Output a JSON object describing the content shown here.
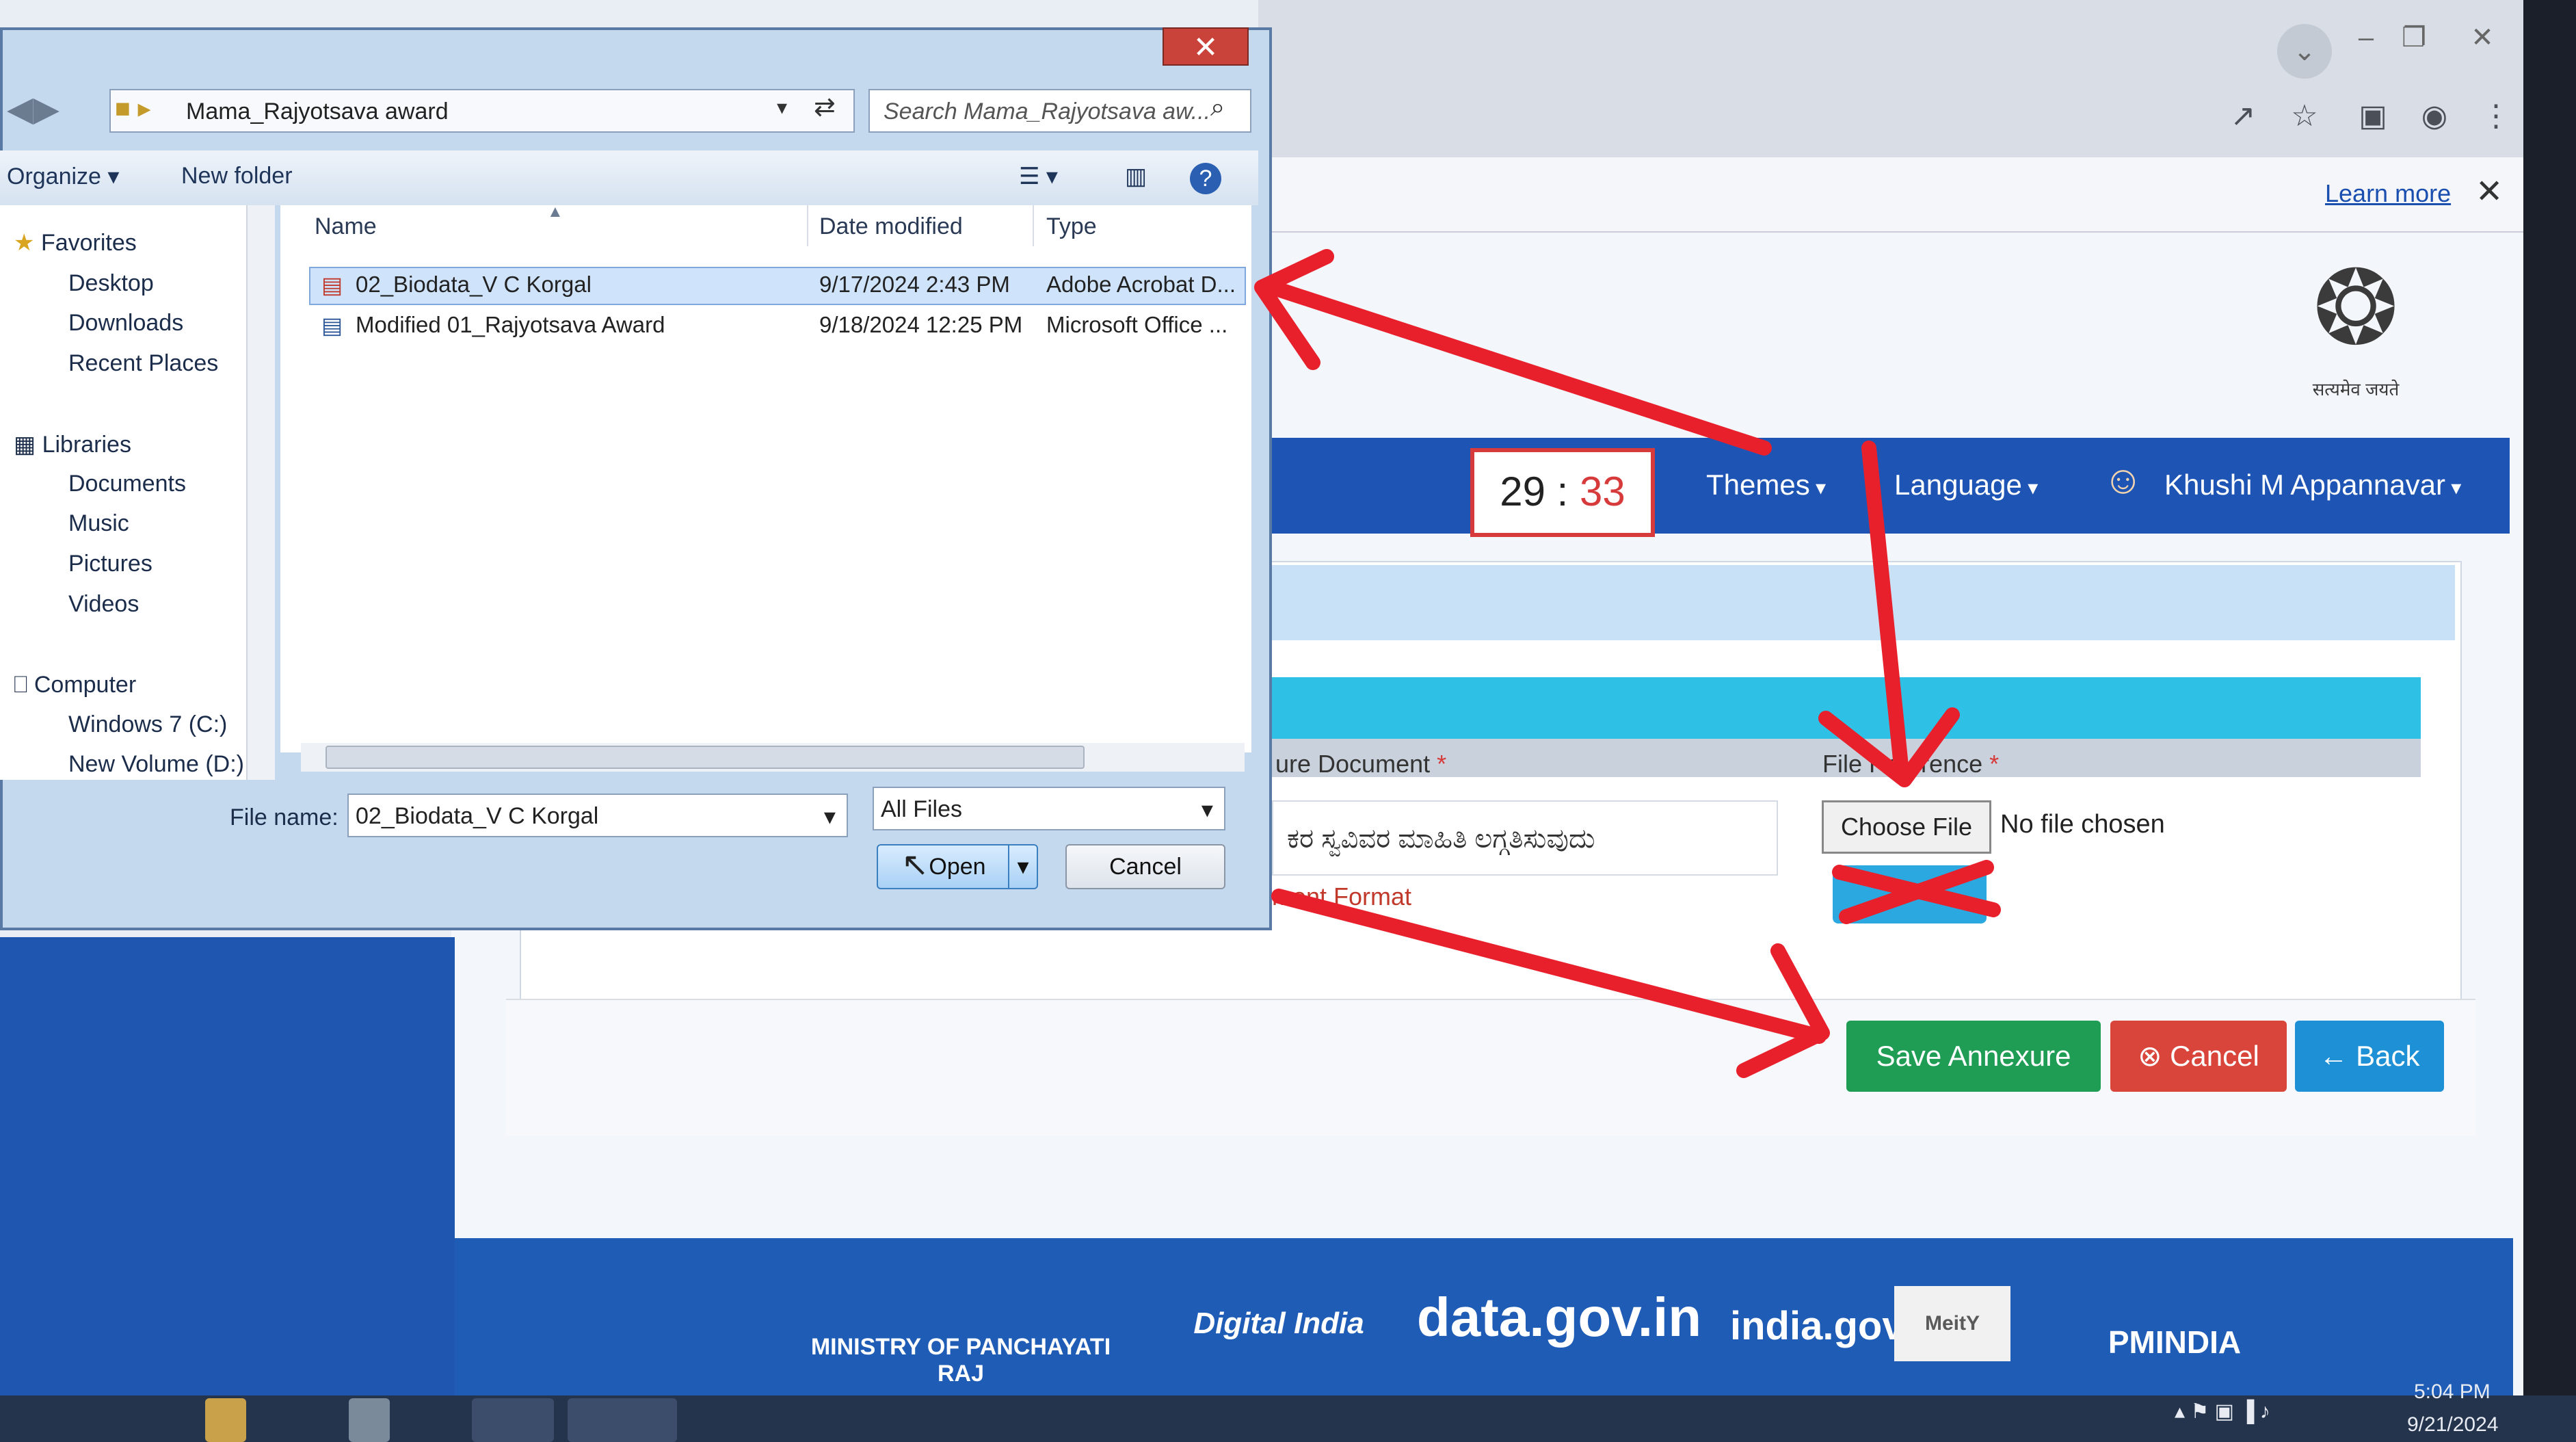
{
  "browser": {
    "infobar_link": "Learn more",
    "emblem_caption": "सत्यमेव जयते",
    "timer": {
      "minutes": "29",
      "colon": ":",
      "seconds": "33"
    },
    "nav": {
      "themes": "Themes",
      "language": "Language",
      "user": "Khushi M Appannavar"
    },
    "form": {
      "document_label": "ure Document",
      "file_reference_label": "File Reference",
      "required_mark": "*",
      "document_value": "ಕರ ಸ್ವವಿವರ ಮಾಹಿತಿ ಲಗ್ಗತಿಸುವುದು",
      "format_hint": "ment Format",
      "choose_file": "Choose File",
      "no_file": "No file chosen"
    },
    "buttons": {
      "save": "Save Annexure",
      "cancel": "Cancel",
      "back": "← Back"
    },
    "footer_logos": [
      "MINISTRY OF PANCHAYATI RAJ",
      "Digital India",
      "data.gov.in",
      "india.gov.in",
      "MeitY",
      "PMINDIA"
    ]
  },
  "dialog": {
    "address_path": "Mama_Rajyotsava award",
    "search_placeholder": "Search Mama_Rajyotsava aw...",
    "toolbar": {
      "organize": "Organize",
      "new_folder": "New folder"
    },
    "nav": {
      "favorites": "Favorites",
      "favorite_items": [
        "Desktop",
        "Downloads",
        "Recent Places"
      ],
      "libraries": "Libraries",
      "library_items": [
        "Documents",
        "Music",
        "Pictures",
        "Videos"
      ],
      "computer": "Computer",
      "computer_items": [
        "Windows 7 (C:)",
        "New Volume (D:)"
      ]
    },
    "columns": {
      "name": "Name",
      "date": "Date modified",
      "type": "Type"
    },
    "files": [
      {
        "name": "02_Biodata_V C Korgal",
        "date": "9/17/2024 2:43 PM",
        "type": "Adobe Acrobat D...",
        "icon": "pdf-icon"
      },
      {
        "name": "Modified 01_Rajyotsava Award",
        "date": "9/18/2024 12:25 PM",
        "type": "Microsoft Office ...",
        "icon": "word-icon"
      }
    ],
    "file_name_label": "File name:",
    "file_name_value": "02_Biodata_V C Korgal",
    "file_type": "All Files",
    "open": "Open",
    "cancel": "Cancel"
  },
  "taskbar": {
    "time": "5:04 PM",
    "date": "9/21/2024"
  },
  "colors": {
    "annotation": "#e8202c",
    "nav_blue": "#1e55b5",
    "save_green": "#1f9d55",
    "cancel_red": "#d9453b",
    "back_blue": "#1e90d6"
  }
}
